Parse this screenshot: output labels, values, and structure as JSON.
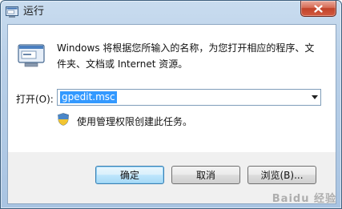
{
  "window": {
    "title": "运行"
  },
  "content": {
    "description": "Windows 将根据您所输入的名称，为您打开相应的程序、文件夹、文档或 Internet 资源。",
    "open_label": "打开(O):",
    "open_value": "gpedit.msc",
    "admin_note": "使用管理权限创建此任务。"
  },
  "buttons": {
    "ok": "确定",
    "cancel": "取消",
    "browse": "浏览(B)..."
  },
  "watermark": "Baidu 经验",
  "icons": [
    "run-app-icon",
    "close-icon",
    "run-dialog-icon",
    "dropdown-arrow-icon",
    "uac-shield-icon"
  ],
  "colors": {
    "selection": "#3399ff",
    "close_button": "#c1432a",
    "default_button_border": "#3c7fb1"
  }
}
